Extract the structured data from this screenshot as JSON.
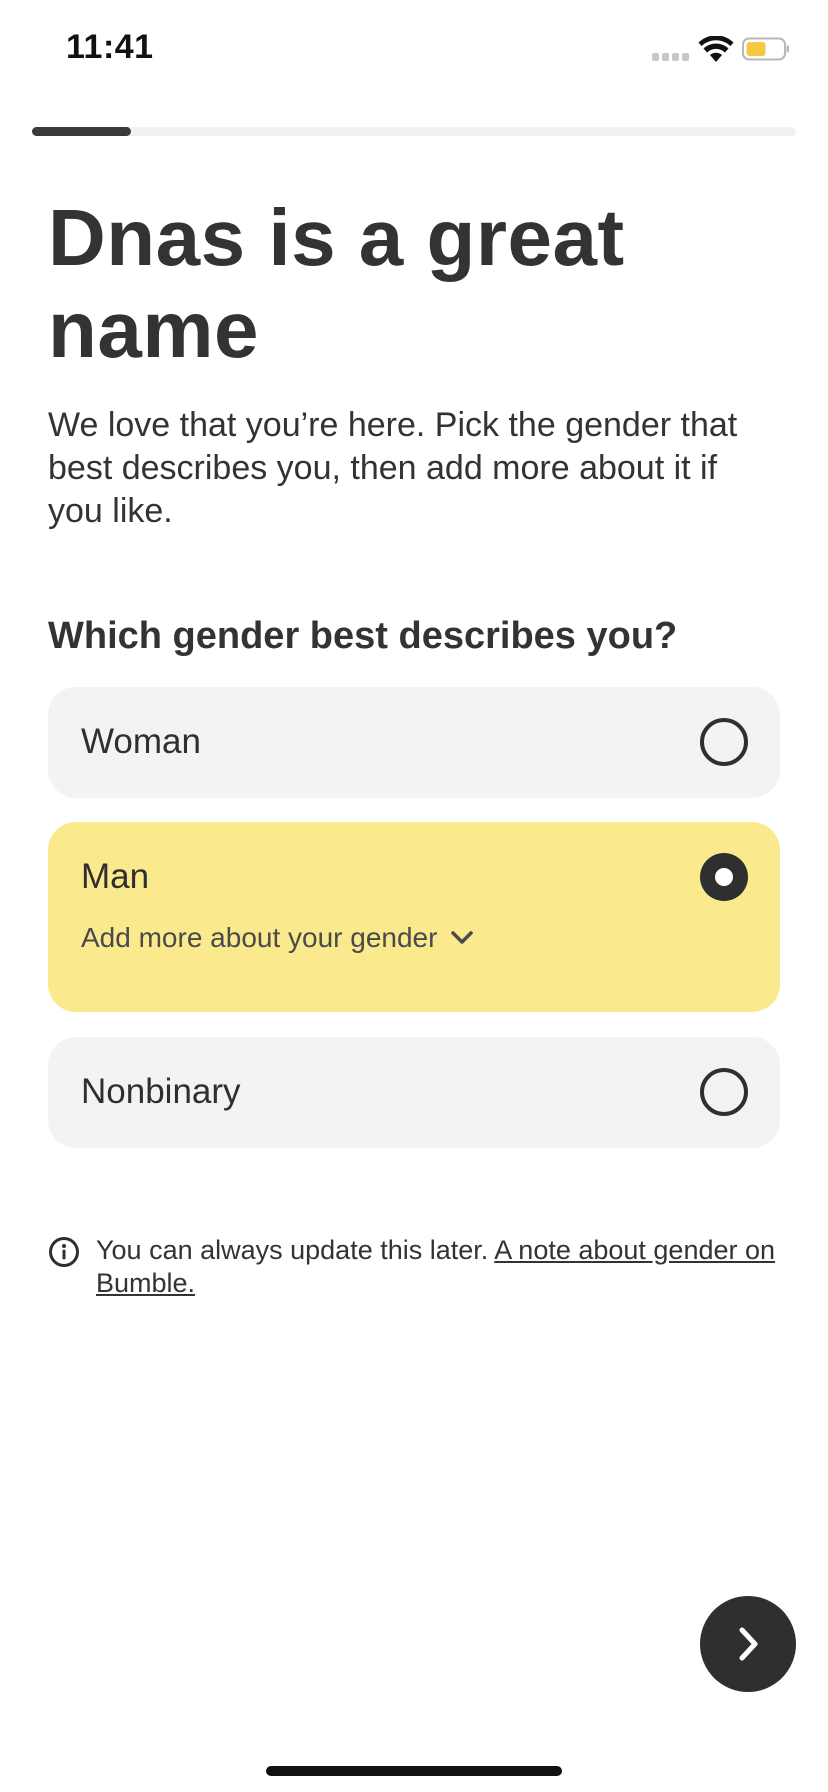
{
  "status_bar": {
    "time": "11:41",
    "icons": [
      "cellular-signal-icon",
      "wifi-icon",
      "battery-icon"
    ],
    "battery_color": "#f5c842"
  },
  "progress": {
    "fraction": 0.13
  },
  "header": {
    "title": "Dnas is a great name",
    "subtitle": "We love that you’re here. Pick the gender that best describes you, then add more about it if you like."
  },
  "question": "Which gender best describes you?",
  "options": [
    {
      "label": "Woman",
      "selected": false
    },
    {
      "label": "Man",
      "selected": true,
      "add_more_label": "Add more about your gender"
    },
    {
      "label": "Nonbinary",
      "selected": false
    }
  ],
  "note": {
    "text": "You can always update this later.",
    "link": "A note about gender on Bumble."
  },
  "next_button": {
    "icon": "chevron-right-icon"
  },
  "colors": {
    "selected_option_bg": "#fbe98d",
    "option_bg": "#f3f3f3",
    "primary_dark": "#2f2f2f"
  }
}
